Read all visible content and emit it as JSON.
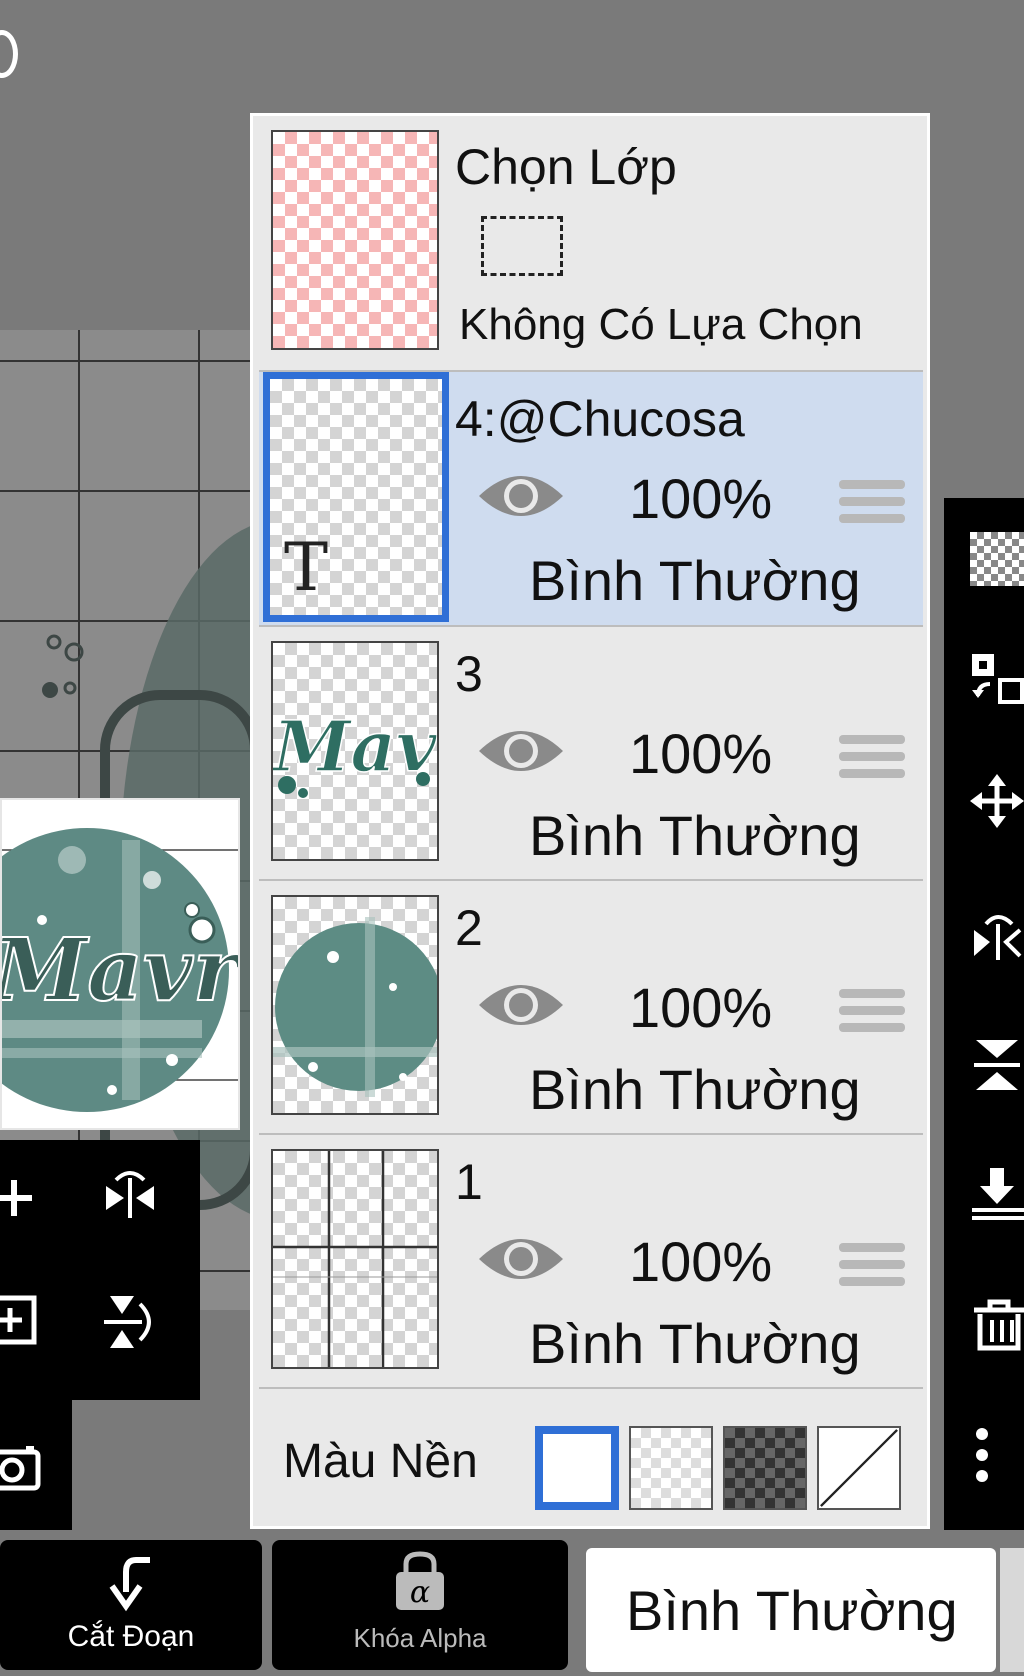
{
  "panel": {
    "selection": {
      "title": "Chọn Lớp",
      "status": "Không Có Lựa Chọn"
    },
    "layers": [
      {
        "name": "4:@Chucosa",
        "opacity": "100%",
        "blend": "Bình Thường",
        "selected": true,
        "thumb_glyph": "T"
      },
      {
        "name": "3",
        "opacity": "100%",
        "blend": "Bình Thường",
        "selected": false
      },
      {
        "name": "2",
        "opacity": "100%",
        "blend": "Bình Thường",
        "selected": false
      },
      {
        "name": "1",
        "opacity": "100%",
        "blend": "Bình Thường",
        "selected": false
      }
    ],
    "background": {
      "label": "Màu Nền",
      "options": [
        "white",
        "transparent-light",
        "transparent-dark",
        "none"
      ],
      "selected": "white"
    }
  },
  "bottom_bar": {
    "clip_label": "Cắt Đoạn",
    "alpha_lock_label": "Khóa Alpha",
    "blend_mode": "Bình Thường"
  },
  "icons": {
    "clip": "arrow-curve-down-icon",
    "alpha_lock": "lock-alpha-icon",
    "visibility": "eye-icon",
    "reorder": "drag-handle-icon"
  },
  "colors": {
    "selected_row": "#cfdcef",
    "selected_outline": "#2f6fd6",
    "panel_bg": "#e9e9e9",
    "teal_art": "#5d8c84"
  }
}
